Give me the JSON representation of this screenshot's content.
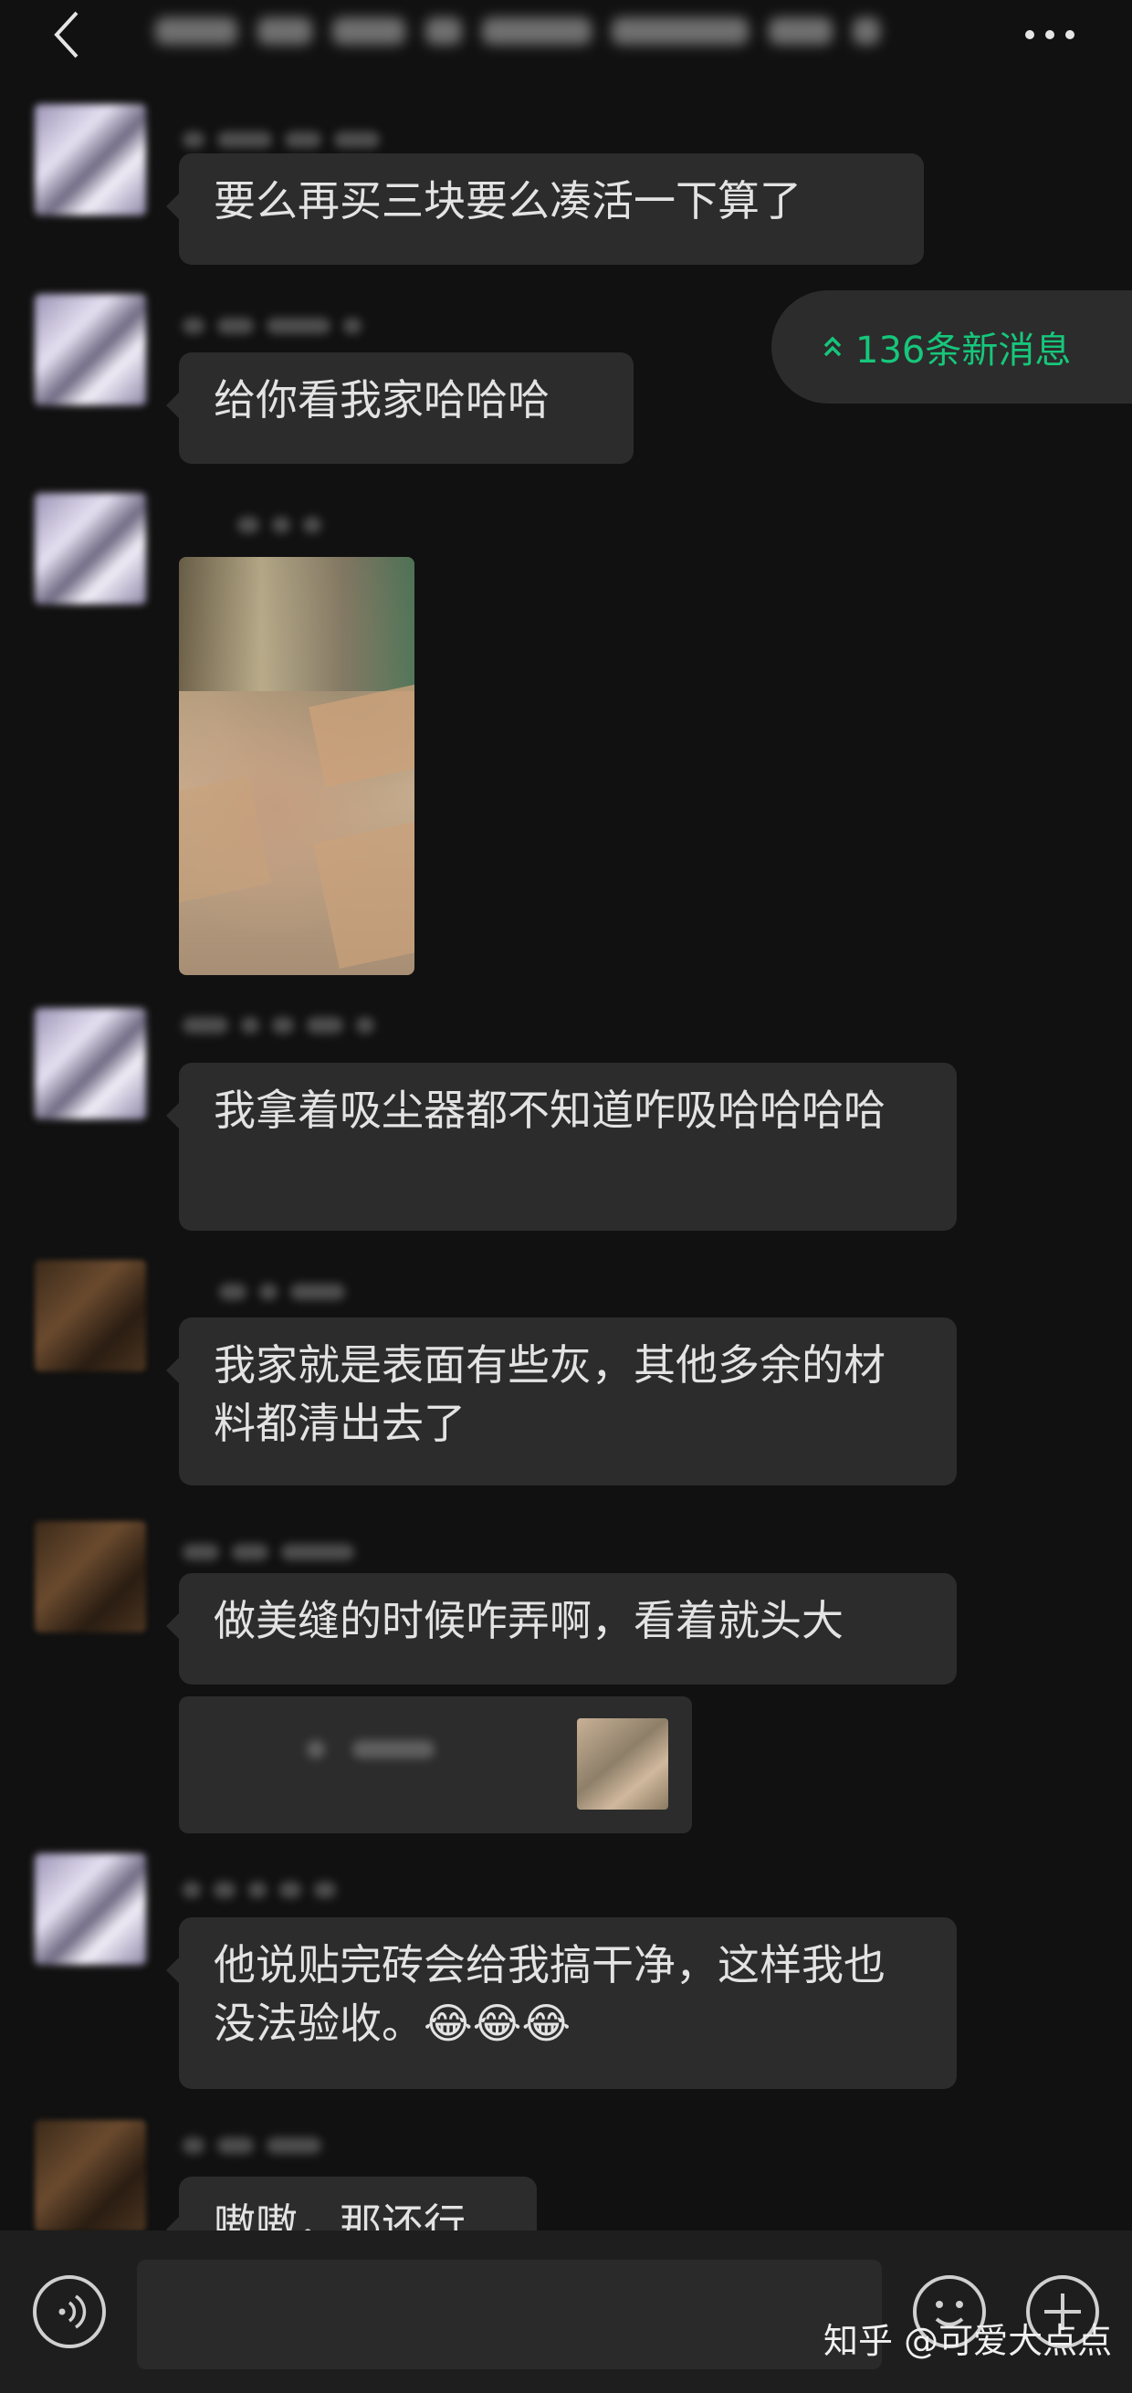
{
  "header": {
    "back_icon": "chevron-left-icon",
    "more_icon": "more-dots-icon"
  },
  "new_messages": {
    "label": "136条新消息",
    "icon": "double-chevron-up-icon",
    "color": "#16c77b"
  },
  "messages": [
    {
      "type": "text",
      "text": "要么再买三块要么凑活一下算了"
    },
    {
      "type": "text",
      "text": "给你看我家哈哈哈"
    },
    {
      "type": "image",
      "description": "photo"
    },
    {
      "type": "text",
      "text": "我拿着吸尘器都不知道咋吸哈哈哈哈"
    },
    {
      "type": "text",
      "text": "我家就是表面有些灰，其他多余的材料都清出去了"
    },
    {
      "type": "text",
      "text": "做美缝的时候咋弄啊，看着就头大"
    },
    {
      "type": "quote"
    },
    {
      "type": "text",
      "text": "他说贴完砖会给我搞干净，这样我也没法验收。😂😂😂"
    },
    {
      "type": "text",
      "text": "嗷嗷，那还行"
    }
  ],
  "bottom_bar": {
    "voice_icon": "voice-icon",
    "emoji_icon": "emoji-icon",
    "plus_icon": "plus-icon"
  },
  "watermark": "知乎 @可爱大点点",
  "colors": {
    "background": "#111111",
    "bubble": "#2c2c2c",
    "accent": "#16c77b"
  }
}
